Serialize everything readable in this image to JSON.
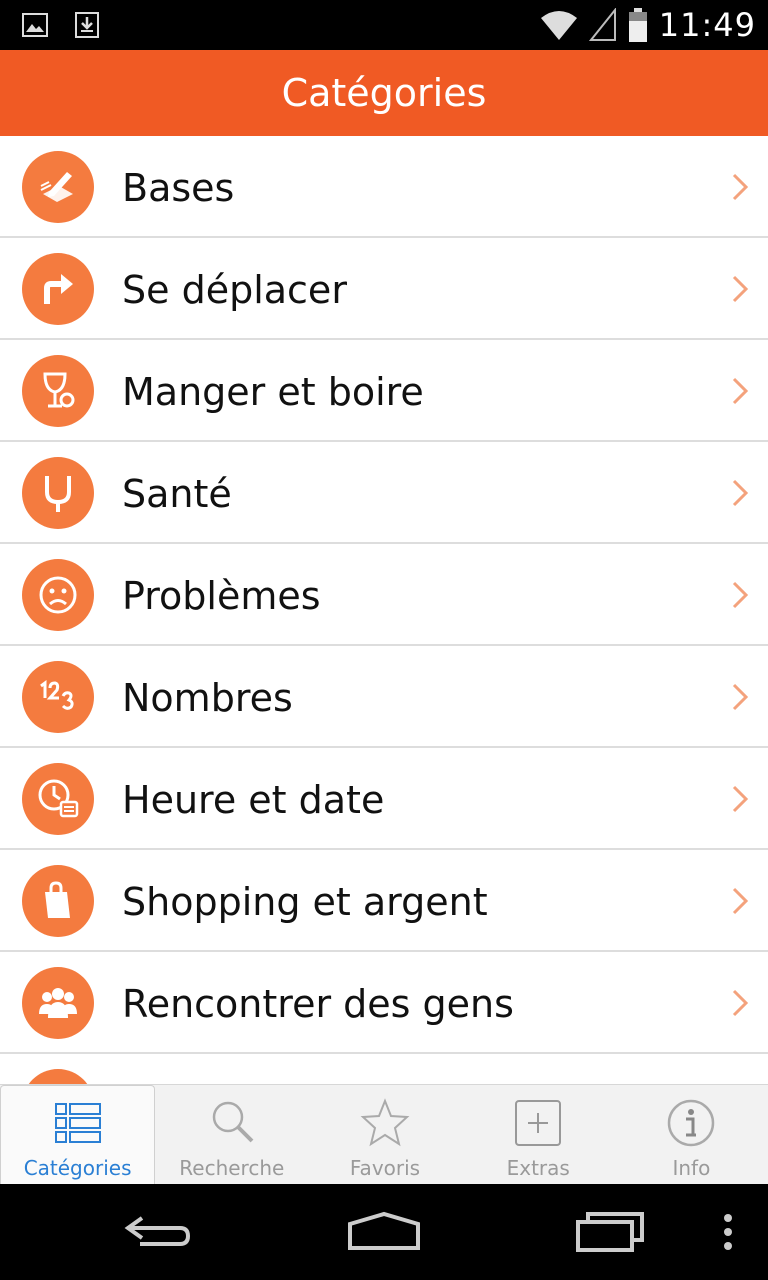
{
  "status_bar": {
    "time": "11:49"
  },
  "header": {
    "title": "Catégories"
  },
  "categories": [
    {
      "label": "Bases",
      "icon": "pencil-paper-icon"
    },
    {
      "label": "Se déplacer",
      "icon": "turn-arrow-icon"
    },
    {
      "label": "Manger et boire",
      "icon": "glass-fork-icon"
    },
    {
      "label": "Santé",
      "icon": "stethoscope-icon"
    },
    {
      "label": "Problèmes",
      "icon": "sad-face-icon"
    },
    {
      "label": "Nombres",
      "icon": "numbers-icon"
    },
    {
      "label": "Heure et date",
      "icon": "clock-calendar-icon"
    },
    {
      "label": "Shopping et argent",
      "icon": "shopping-bag-icon"
    },
    {
      "label": "Rencontrer des gens",
      "icon": "people-icon"
    }
  ],
  "tabs": [
    {
      "label": "Catégories",
      "icon": "list-grid-icon",
      "active": true
    },
    {
      "label": "Recherche",
      "icon": "search-icon",
      "active": false
    },
    {
      "label": "Favoris",
      "icon": "star-icon",
      "active": false
    },
    {
      "label": "Extras",
      "icon": "plus-box-icon",
      "active": false
    },
    {
      "label": "Info",
      "icon": "info-icon",
      "active": false
    }
  ],
  "colors": {
    "accent": "#f05a24",
    "icon_bg": "#f47b3f",
    "active_tab": "#2a7fd4",
    "inactive_tab": "#9a9a9a"
  }
}
